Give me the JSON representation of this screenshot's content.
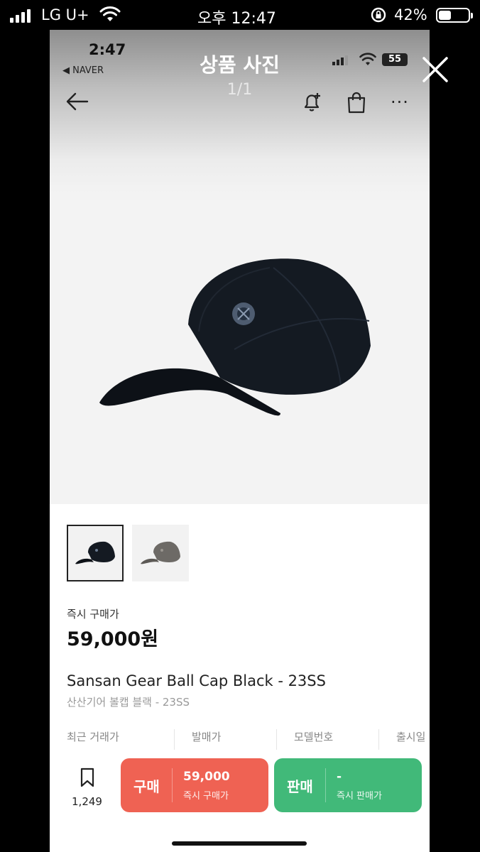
{
  "outer_status": {
    "carrier": "LG U+",
    "time": "오후 12:47",
    "battery_percent": "42%",
    "battery_level": 0.42
  },
  "inner_status": {
    "time": "2:47",
    "back_app": "◀ NAVER",
    "battery": "55"
  },
  "viewer": {
    "title": "상품 사진",
    "counter": "1/1"
  },
  "header_icons": [
    "back-arrow-icon",
    "bell-plus-icon",
    "shopping-bag-icon",
    "more-icon"
  ],
  "product": {
    "instant_price_label": "즉시 구매가",
    "price": "59,000원",
    "name_en": "Sansan Gear Ball Cap Black - 23SS",
    "name_kr": "산산기어 볼캡 블랙 - 23SS",
    "thumbnails": [
      {
        "color": "#141a22",
        "selected": true
      },
      {
        "color": "#6d6a66",
        "selected": false
      }
    ],
    "info_labels": [
      "최근 거래가",
      "발매가",
      "모델번호",
      "출시일"
    ]
  },
  "bottom_bar": {
    "wish_count": "1,249",
    "buy": {
      "label": "구매",
      "price": "59,000",
      "sub": "즉시 구매가"
    },
    "sell": {
      "label": "판매",
      "price": "-",
      "sub": "즉시 판매가"
    }
  },
  "colors": {
    "buy": "#ef6253",
    "sell": "#41b979",
    "cap": "#141a22"
  }
}
